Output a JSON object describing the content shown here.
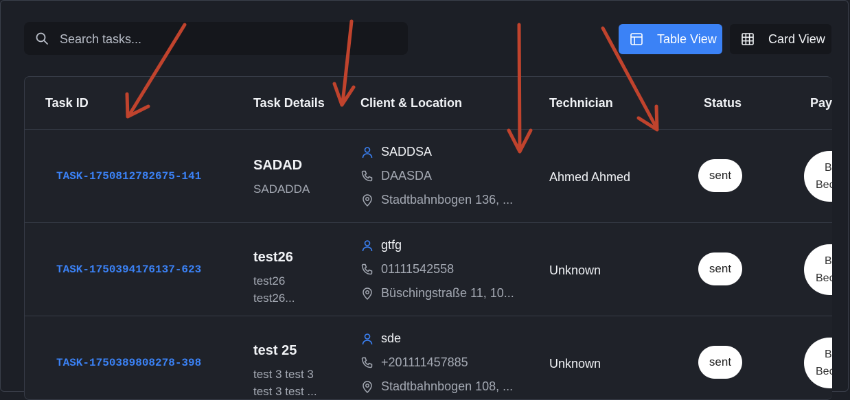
{
  "search": {
    "placeholder": "Search tasks..."
  },
  "view_toggle": {
    "table_label": "Table View",
    "card_label": "Card View"
  },
  "table": {
    "headers": [
      "Task ID",
      "Task Details",
      "Client & Location",
      "Technician",
      "Status",
      "Payr"
    ],
    "rows": [
      {
        "task_id": "TASK-1750812782675-141",
        "title": "SADAD",
        "desc_lines": [
          "SADADDA"
        ],
        "client": "SADDSA",
        "phone": "DAASDA",
        "location": "Stadtbahnbogen 136, ...",
        "technician": "Ahmed Ahmed",
        "status": "sent",
        "payment": [
          "B",
          "Bec"
        ]
      },
      {
        "task_id": "TASK-1750394176137-623",
        "title": "test26",
        "desc_lines": [
          "test26",
          "test26..."
        ],
        "client": "gtfg",
        "phone": "01111542558",
        "location": "Büschingstraße 11, 10...",
        "technician": "Unknown",
        "status": "sent",
        "payment": [
          "B",
          "Bec"
        ]
      },
      {
        "task_id": "TASK-1750389808278-398",
        "title": "test 25",
        "desc_lines": [
          "test 3 test 3",
          "test 3 test ..."
        ],
        "client": "sde",
        "phone": "+201111457885",
        "location": "Stadtbahnbogen 108, ...",
        "technician": "Unknown",
        "status": "sent",
        "payment": [
          "B",
          "Bec"
        ]
      }
    ]
  },
  "colors": {
    "accent": "#3b82f6",
    "annotation_arrow": "#c0432d",
    "background": "#1c1f26"
  },
  "icons": [
    "search-icon",
    "table-icon",
    "grid-icon",
    "user-icon",
    "phone-icon",
    "map-pin-icon"
  ]
}
